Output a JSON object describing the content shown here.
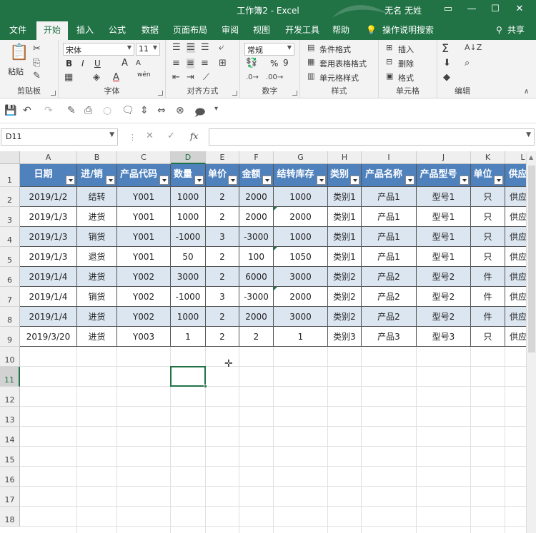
{
  "window": {
    "title": "工作簿2  -  Excel",
    "user": "无名 无姓",
    "min": "—",
    "restore": "☐",
    "close": "✕"
  },
  "tabs": [
    "文件",
    "开始",
    "插入",
    "公式",
    "数据",
    "页面布局",
    "审阅",
    "视图",
    "开发工具",
    "帮助",
    "操作说明搜索",
    "共享"
  ],
  "ribbon": {
    "clipboard": {
      "label": "剪贴板",
      "paste": "粘贴"
    },
    "font": {
      "label": "字体",
      "name": "宋体",
      "size": "11",
      "bold": "B",
      "italic": "I",
      "underline": "U",
      "grow": "A",
      "shrink": "A",
      "wen": "wén"
    },
    "align": {
      "label": "对齐方式"
    },
    "number": {
      "label": "数字",
      "format": "常规",
      "percent": "%",
      "comma": "9"
    },
    "styles": {
      "label": "样式",
      "cond": "条件格式",
      "table": "套用表格格式",
      "cell": "单元格样式"
    },
    "cells": {
      "label": "单元格",
      "insert": "插入",
      "delete": "删除",
      "format": "格式"
    },
    "edit": {
      "label": "编辑",
      "sum": "Σ"
    }
  },
  "formula_bar": {
    "name_box": "D11",
    "fx": "fx",
    "formula": ""
  },
  "columns": [
    "A",
    "B",
    "C",
    "D",
    "E",
    "F",
    "G",
    "H",
    "I",
    "J",
    "K",
    "L"
  ],
  "rows": [
    "1",
    "2",
    "3",
    "4",
    "5",
    "6",
    "7",
    "8",
    "9",
    "10",
    "11",
    "12",
    "13",
    "14",
    "15",
    "16",
    "17",
    "18"
  ],
  "table": {
    "headers": [
      "日期",
      "进/销",
      "产品代码",
      "数量",
      "单价",
      "金额",
      "结转库存",
      "类别",
      "产品名称",
      "产品型号",
      "单位",
      "供应"
    ],
    "rows": [
      [
        "2019/1/2",
        "结转",
        "Y001",
        "1000",
        "2",
        "2000",
        "1000",
        "类别1",
        "产品1",
        "型号1",
        "只",
        "供应"
      ],
      [
        "2019/1/3",
        "进货",
        "Y001",
        "1000",
        "2",
        "2000",
        "2000",
        "类别1",
        "产品1",
        "型号1",
        "只",
        "供应"
      ],
      [
        "2019/1/3",
        "销货",
        "Y001",
        "-1000",
        "3",
        "-3000",
        "1000",
        "类别1",
        "产品1",
        "型号1",
        "只",
        "供应"
      ],
      [
        "2019/1/3",
        "退货",
        "Y001",
        "50",
        "2",
        "100",
        "1050",
        "类别1",
        "产品1",
        "型号1",
        "只",
        "供应"
      ],
      [
        "2019/1/4",
        "进货",
        "Y002",
        "3000",
        "2",
        "6000",
        "3000",
        "类别2",
        "产品2",
        "型号2",
        "件",
        "供应"
      ],
      [
        "2019/1/4",
        "销货",
        "Y002",
        "-1000",
        "3",
        "-3000",
        "2000",
        "类别2",
        "产品2",
        "型号2",
        "件",
        "供应"
      ],
      [
        "2019/1/4",
        "进货",
        "Y002",
        "1000",
        "2",
        "2000",
        "3000",
        "类别2",
        "产品2",
        "型号2",
        "件",
        "供应"
      ],
      [
        "2019/3/20",
        "进货",
        "Y003",
        "1",
        "2",
        "2",
        "1",
        "类别3",
        "产品3",
        "型号3",
        "只",
        "供应"
      ]
    ]
  },
  "colors": {
    "accent": "#217346",
    "header_fill": "#4f81bd",
    "band_fill": "#dce6f1"
  }
}
